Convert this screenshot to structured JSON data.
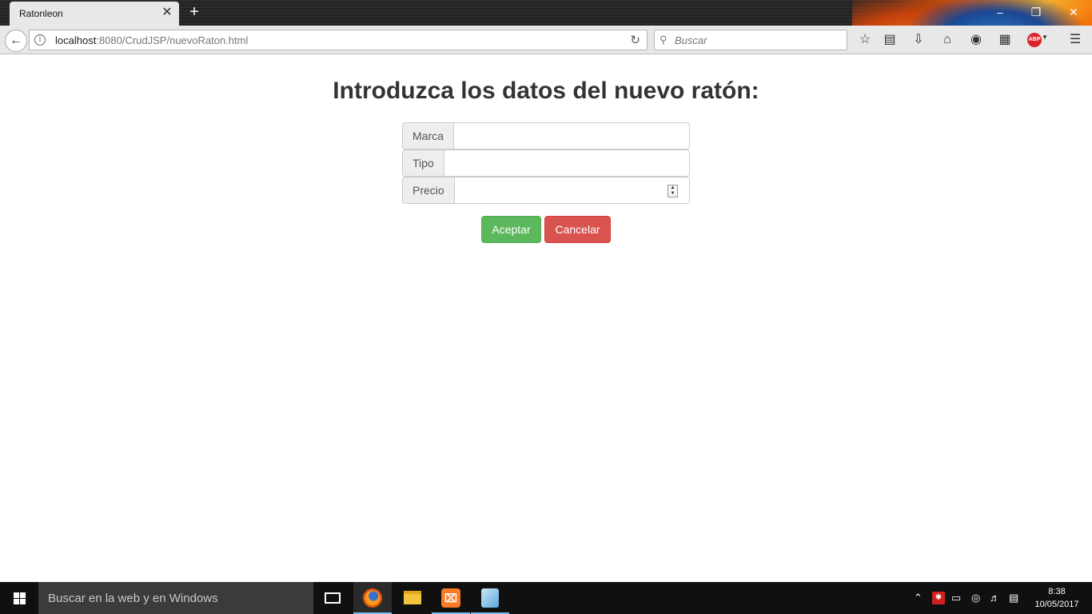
{
  "browser": {
    "tab_title": "Ratonleon",
    "url_host": "localhost",
    "url_rest": ":8080/CrudJSP/nuevoRaton.html",
    "search_placeholder": "Buscar"
  },
  "page": {
    "heading": "Introduzca los datos del nuevo ratón:",
    "fields": [
      {
        "label": "Marca",
        "value": ""
      },
      {
        "label": "Tipo",
        "value": ""
      },
      {
        "label": "Precio",
        "value": ""
      }
    ],
    "buttons": {
      "accept": "Aceptar",
      "cancel": "Cancelar"
    }
  },
  "taskbar": {
    "search_placeholder": "Buscar en la web y en Windows",
    "time": "8:38",
    "date": "10/05/2017"
  }
}
